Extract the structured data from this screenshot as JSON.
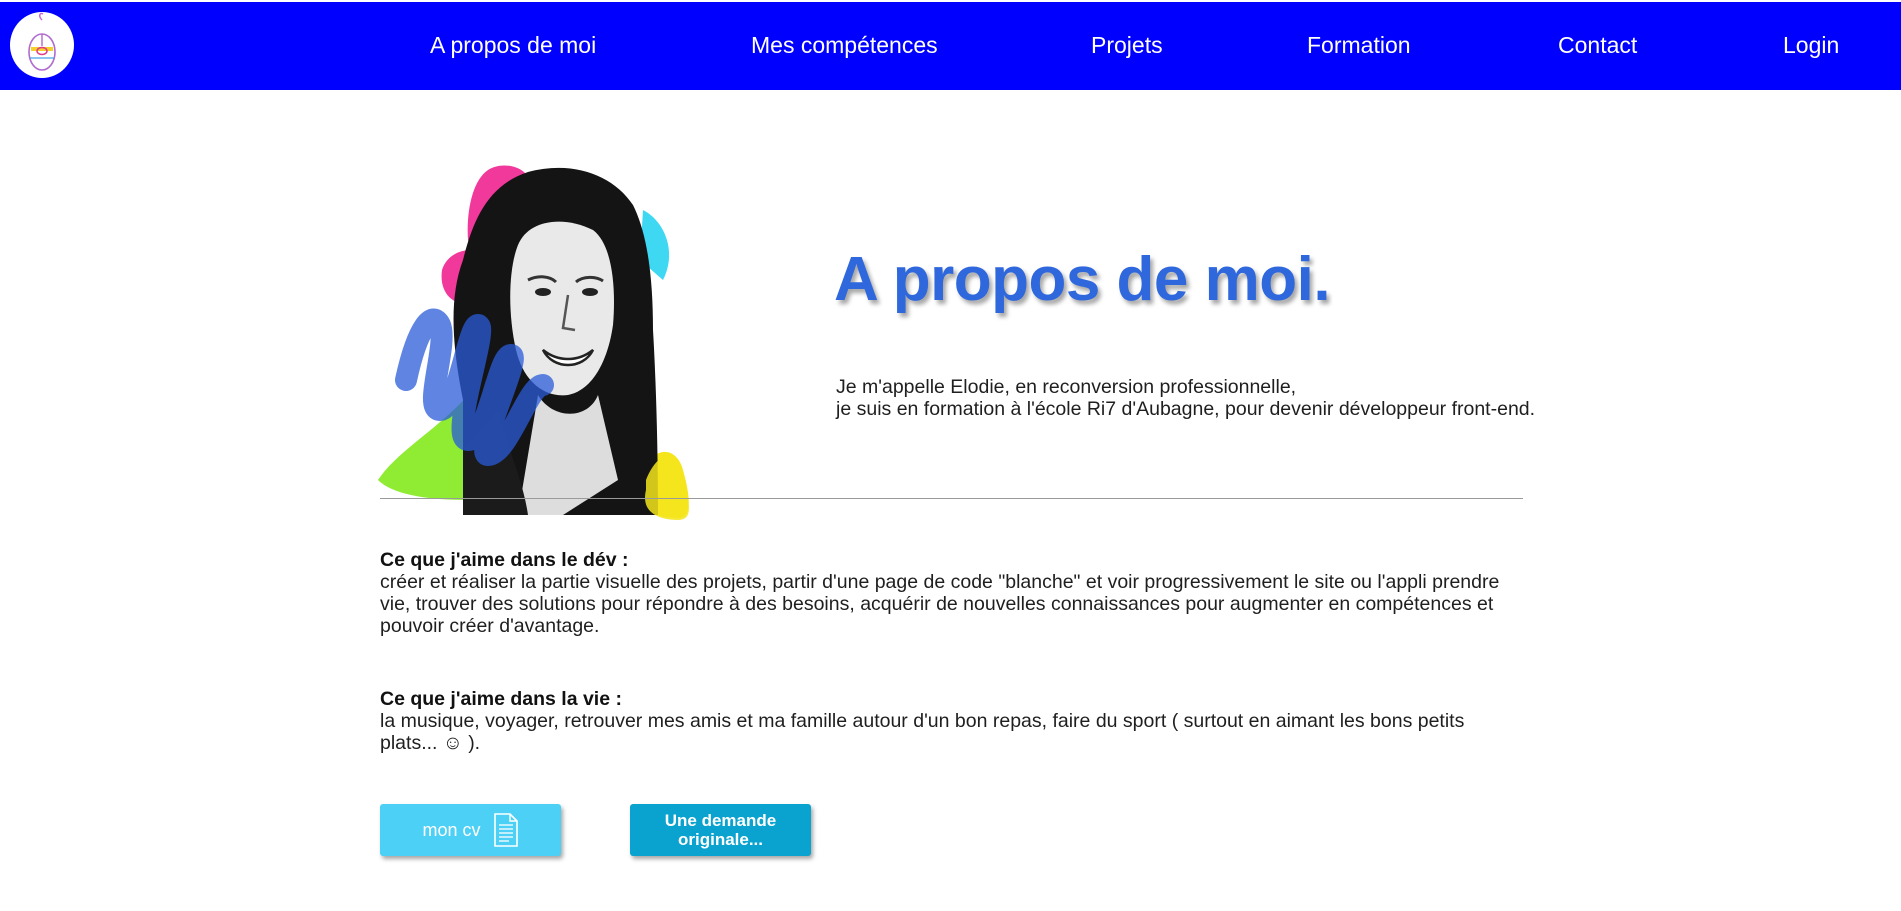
{
  "nav": {
    "items": [
      {
        "label": "A propos de moi"
      },
      {
        "label": "Mes compétences"
      },
      {
        "label": "Projets"
      },
      {
        "label": "Formation"
      },
      {
        "label": "Contact"
      },
      {
        "label": "Login"
      }
    ]
  },
  "about": {
    "title": "A propos de moi.",
    "intro": [
      "Je m'appelle Elodie, en reconversion professionnelle,",
      "je suis en formation à l'école Ri7 d'Aubagne, pour devenir développeur front-end."
    ]
  },
  "sections": {
    "dev": {
      "heading": "Ce que j'aime dans le dév :",
      "body": "créer et réaliser la partie visuelle des projets, partir d'une page de code \"blanche\" et voir progressivement le site ou l'appli prendre vie, trouver des solutions pour répondre à des besoins, acquérir de nouvelles connaissances pour augmenter en compétences et pouvoir créer d'avantage."
    },
    "vie": {
      "heading": "Ce que j'aime dans la vie :",
      "body": "la musique, voyager, retrouver mes amis et ma famille autour d'un bon repas, faire du sport ( surtout en aimant les bons petits plats... ☺ )."
    }
  },
  "buttons": {
    "cv_label": "mon cv",
    "demande_label": "Une demande originale..."
  },
  "icons": {
    "logo": "mouse-logo-icon",
    "cv": "document-icon"
  },
  "colors": {
    "nav_bg": "#0000fe",
    "title": "#2f67dc",
    "cv_button": "#4dd0f5",
    "demande_button": "#0aa3cf"
  }
}
